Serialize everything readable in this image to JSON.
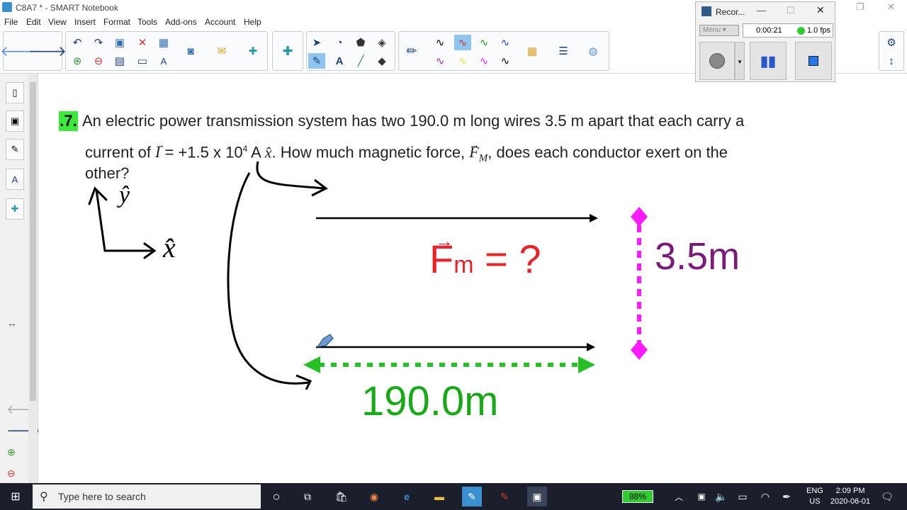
{
  "window": {
    "title": "C8A7 * - SMART Notebook"
  },
  "menu": [
    "File",
    "Edit",
    "View",
    "Insert",
    "Format",
    "Tools",
    "Add-ons",
    "Account",
    "Help"
  ],
  "question": {
    "number": ".7.",
    "line1": "An electric power transmission system has two 190.0 m long wires 3.5 m apart that each carry a",
    "line2_a": "current of ",
    "line2_i": "I",
    "line2_b": " = +1.5 x 10",
    "line2_exp": "4",
    "line2_c": " A ",
    "line2_xhat": "x̂",
    "line2_d": ". How much magnetic force, ",
    "line2_f": "F",
    "line2_m": "M",
    "line2_e": ", does each conductor exert on the",
    "line3": "other?"
  },
  "annotations": {
    "y_axis": "ŷ",
    "x_axis": "x̂",
    "force": "F",
    "force_sub": "m",
    "force_rest": "= ?",
    "spacing": "3.5m",
    "length": "190.0m"
  },
  "recorder": {
    "title": "Recor...",
    "menu": "Menu",
    "time": "0:00:21",
    "fps": "1.0 fps"
  },
  "taskbar": {
    "search_placeholder": "Type here to search",
    "battery": "88%",
    "lang1": "ENG",
    "lang2": "US",
    "time": "2:09 PM",
    "date": "2020-06-01"
  },
  "colors": {
    "red": "#e8232a",
    "magenta": "#ff19ff",
    "green": "#18a818",
    "purple": "#7a1a7a",
    "highlight": "#3de83d"
  }
}
